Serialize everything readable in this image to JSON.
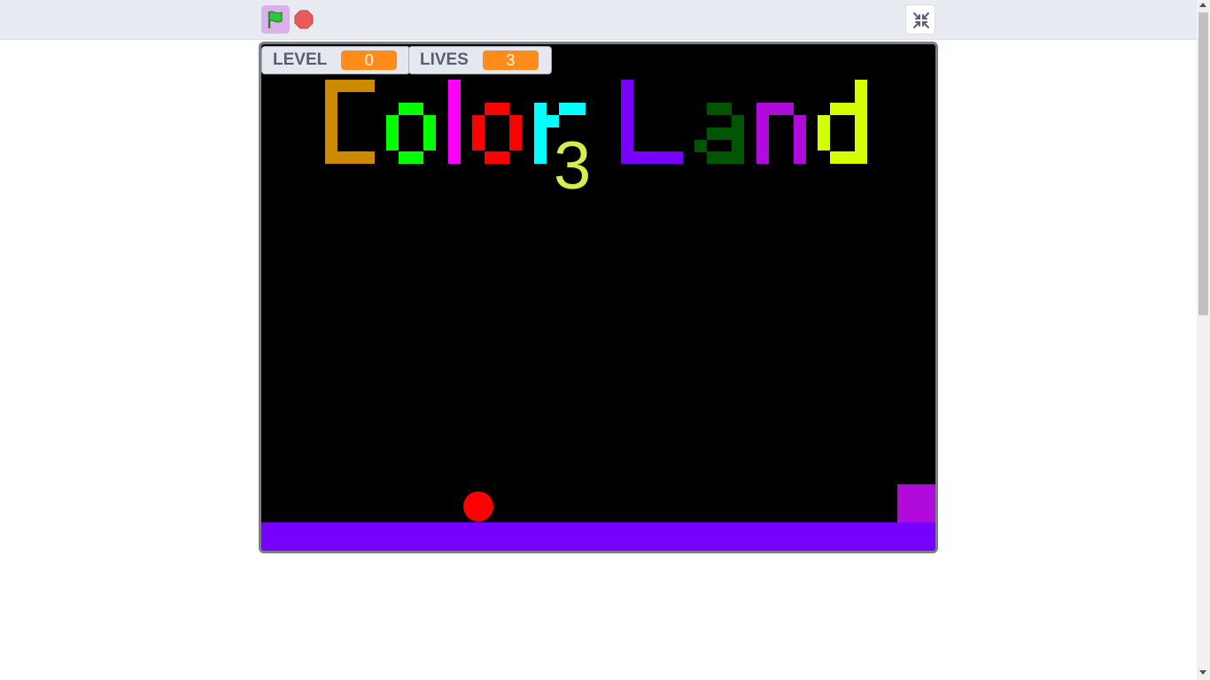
{
  "toolbar": {
    "green_flag_icon": "green-flag-icon",
    "stop_icon": "stop-sign-icon",
    "fullscreen_icon": "exit-fullscreen-icon",
    "green_flag_active_color": "#d9b2ec"
  },
  "monitors": {
    "level": {
      "label": "LEVEL",
      "value": "0"
    },
    "lives": {
      "label": "LIVES",
      "value": "3"
    }
  },
  "stage": {
    "title_word_1": "Color",
    "title_word_2": "Land",
    "title_number": "3",
    "letter_colors": [
      "#cc8a00",
      "#00ff00",
      "#ff00ff",
      "#ff0000",
      "#00ffff",
      "#7700ff",
      "#005500",
      "#b10bdc",
      "#d4ff00"
    ],
    "background_color": "#000000",
    "floor_color": "#7700ff",
    "ball_color": "#ff0000",
    "goal_color": "#b10bdc"
  }
}
